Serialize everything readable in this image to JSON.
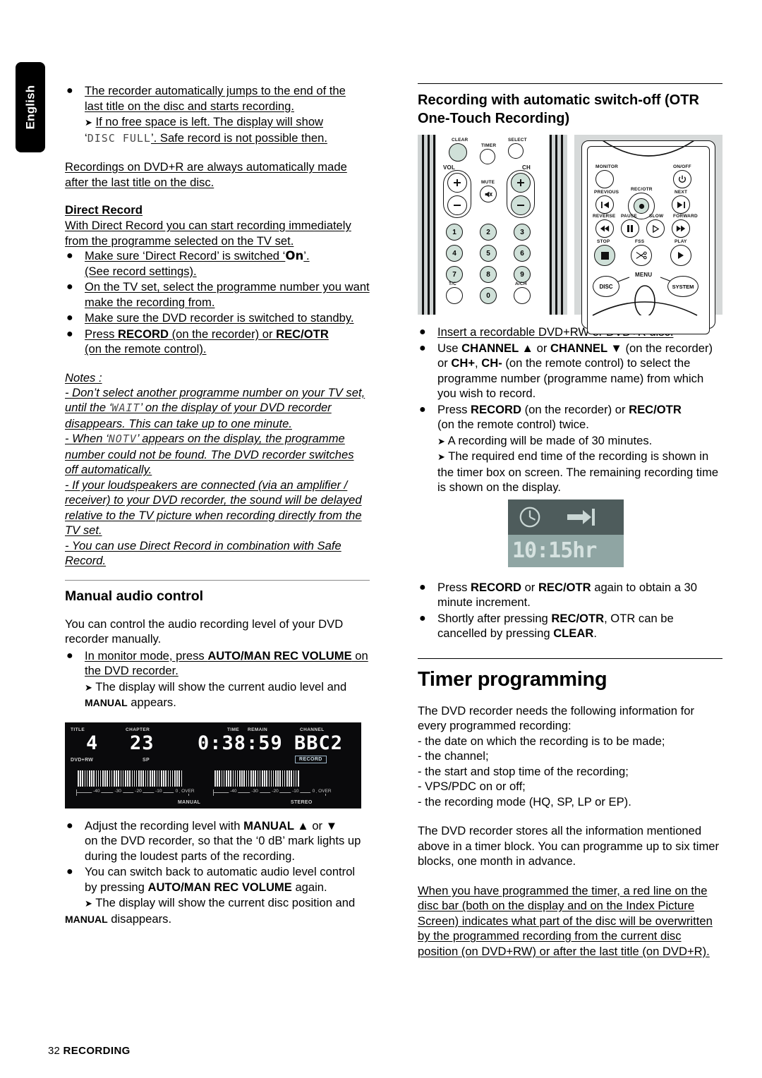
{
  "sidebar_tab": {
    "label": "English"
  },
  "footer": {
    "page_number": "32",
    "section": "RECORDING"
  },
  "left_column": {
    "b1_line1": "The recorder automatically jumps to the end of the",
    "b1_line2": "last title on the disc and starts recording.",
    "b1_arrow1": "If no free space is left. The display will show",
    "b1_arrow2_pre": "‘",
    "b1_arrow2_seg": "DISC FULL",
    "b1_arrow2_post": "’. Safe record is not possible then.",
    "p_dvdr": "Recordings on DVD+R are always automatically made after the last title on the disc.",
    "direct_record_heading": "Direct Record",
    "direct_record_intro": "With Direct Record you can start recording immediately from the programme selected on the TV set.",
    "dr_b1_a": "Make sure ‘Direct Record’ is switched ‘",
    "dr_b1_on": "On",
    "dr_b1_b": "’.",
    "dr_b1_line2": "(See record settings).",
    "dr_b2": "On the TV set, select the programme number you want make the recording from.",
    "dr_b3": "Make sure the DVD recorder is switched to standby.",
    "dr_b4_pre": "Press ",
    "dr_b4_bold1": "RECORD",
    "dr_b4_mid": " (on the recorder) or ",
    "dr_b4_bold2": "REC/OTR",
    "dr_b4_line2": "(on the remote control).",
    "notes_label": "Notes :",
    "note1_a": "- Don’t select another programme number on your TV set, until the ‘",
    "note1_seg": "WAIT",
    "note1_b": "’ on the display of your DVD recorder disappears. This can take up to one minute.",
    "note2_a": "- When ‘",
    "note2_seg": "NOTV",
    "note2_b": "’ appears on the display, the programme number could not be found. The DVD recorder switches off automatically.",
    "note3": "- If your loudspeakers are connected (via an amplifier / receiver) to your DVD recorder, the sound will be delayed relative to the TV picture when recording directly from the TV set.",
    "note4": "- You can use Direct Record in combination with Safe Record.",
    "manual_audio_heading": "Manual audio control",
    "ma_intro": "You can control the audio recording level of your DVD recorder manually.",
    "ma_b1_pre": "In monitor mode, press ",
    "ma_b1_bold": "AUTO/MAN REC VOLUME",
    "ma_b1_post": " on the DVD recorder.",
    "ma_arrow_a": "The display will show the current audio level and ",
    "ma_arrow_bold": "MANUAL",
    "ma_arrow_b": " appears.",
    "ma_b2_pre": "Adjust the recording level with ",
    "ma_b2_bold": "MANUAL ▲",
    "ma_b2_mid": " or ",
    "ma_b2_bold2": "▼",
    "ma_b2_rest": "on the DVD recorder, so that the ‘0 dB’ mark lights up during the loudest parts of the recording.",
    "ma_b3_pre": "You can switch back to automatic audio level control by pressing ",
    "ma_b3_bold": "AUTO/MAN REC VOLUME",
    "ma_b3_post": " again.",
    "ma_arrow2_a": "The display will show the current disc position and ",
    "ma_arrow2_bold": "MANUAL",
    "ma_arrow2_b": " disappears."
  },
  "vfd_display": {
    "label_title": "TITLE",
    "label_chapter": "CHAPTER",
    "label_time": "TIME",
    "label_remain": "REMAIN",
    "label_channel": "CHANNEL",
    "value_title": "4",
    "value_chapter": "23",
    "value_time": "0:38:59",
    "value_channel": "BBC2",
    "disc_type": "DVD+RW",
    "rec_mode": "SP",
    "record_indicator": "RECORD",
    "manual_indicator": "MANUAL",
    "stereo_indicator": "STEREO",
    "scale_ticks": [
      "-40",
      "-30",
      "-20",
      "-10",
      "0",
      "OVER"
    ]
  },
  "remote": {
    "left": {
      "clear": "CLEAR",
      "timer": "TIMER",
      "select": "SELECT",
      "vol": "VOL",
      "ch": "CH",
      "mute": "MUTE",
      "keys": [
        "1",
        "2",
        "3",
        "4",
        "5",
        "6",
        "7",
        "8",
        "9",
        "0"
      ],
      "tc": "T/C",
      "ach": "A/CH"
    },
    "right": {
      "monitor": "MONITOR",
      "onoff": "ON/OFF",
      "previous": "PREVIOUS",
      "rec_otr": "REC/OTR",
      "next": "NEXT",
      "reverse": "REVERSE",
      "pause": "PAUSE",
      "slow": "SLOW",
      "forward": "FORWARD",
      "stop": "STOP",
      "fss": "FSS",
      "play": "PLAY",
      "disc": "DISC",
      "menu": "MENU",
      "system": "SYSTEM"
    }
  },
  "right_column": {
    "otr_heading_line1": "Recording with automatic switch-off (OTR",
    "otr_heading_line2": "One-Touch Recording)",
    "otr_b1": "Insert a recordable DVD+RW or DVD+R disc.",
    "otr_b2_pre": "Use ",
    "otr_b2_bold1": "CHANNEL ▲",
    "otr_b2_mid1": " or ",
    "otr_b2_bold2": "CHANNEL ▼",
    "otr_b2_mid2": " (on the recorder) or ",
    "otr_b2_bold3": "CH+",
    "otr_b2_mid3": ", ",
    "otr_b2_bold4": "CH-",
    "otr_b2_rest": " (on the remote control) to select the programme number (programme name) from which you wish to record.",
    "otr_b3_pre": "Press ",
    "otr_b3_bold1": "RECORD",
    "otr_b3_mid": " (on the recorder) or ",
    "otr_b3_bold2": "REC/OTR",
    "otr_b3_line2": "(on the remote control) twice.",
    "otr_arrow1": "A recording will be made of 30 minutes.",
    "otr_arrow2": "The required end time of the recording is shown in the timer box on screen. The remaining recording time is shown on the display.",
    "timer_box_value": "10:15hr",
    "otr_b4_pre": "Press ",
    "otr_b4_bold1": "RECORD",
    "otr_b4_mid": " or ",
    "otr_b4_bold2": "REC/OTR",
    "otr_b4_rest": " again to obtain a 30 minute increment.",
    "otr_b5_pre": "Shortly after pressing ",
    "otr_b5_bold1": "REC/OTR",
    "otr_b5_mid": ", OTR can be cancelled by pressing ",
    "otr_b5_bold2": "CLEAR",
    "otr_b5_post": ".",
    "timer_prog_heading": "Timer programming",
    "tp_intro": "The DVD recorder needs the following information for every programmed recording:",
    "tp_items": [
      "- the date on which the recording is to be made;",
      "- the channel;",
      "- the start and stop time of the recording;",
      "- VPS/PDC on or off;",
      "- the recording mode (HQ, SP, LP or EP)."
    ],
    "tp_para2": "The DVD recorder stores all the information mentioned above in a timer block. You can programme up to six timer blocks, one month in advance.",
    "tp_para3": "When you have programmed the timer, a red line on the disc bar (both on the display and on the Index Picture Screen) indicates what part of the disc will be overwritten by the programmed recording from the current disc position (on DVD+RW) or after the last title (on DVD+R)."
  }
}
